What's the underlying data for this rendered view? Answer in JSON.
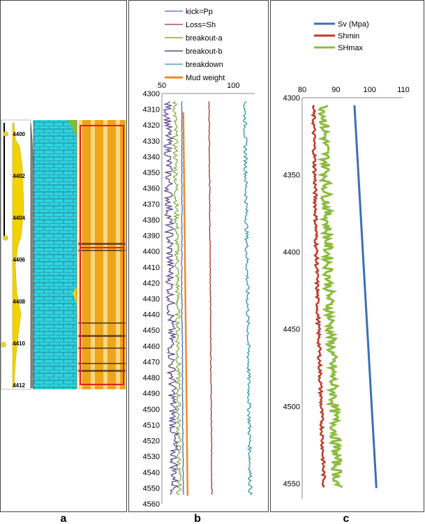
{
  "panel_labels": [
    "a",
    "b",
    "c"
  ],
  "panel_a": {
    "depth_ticks": [
      "4400",
      "4402",
      "4404",
      "4406",
      "4408",
      "4410",
      "4412"
    ],
    "colors": {
      "limestone": "#2fd2e0",
      "brick_line": "#1f6f76",
      "gamma": "#f2d200",
      "core": "#f0a419",
      "core_box": "#e02020"
    }
  },
  "chart_data": [
    {
      "type": "line",
      "x_ticks": [
        "50",
        "100"
      ],
      "xlim": [
        50,
        115
      ],
      "y_ticks": [
        "4300",
        "4310",
        "4320",
        "4330",
        "4340",
        "4350",
        "4360",
        "4370",
        "4380",
        "4390",
        "4400",
        "4410",
        "4420",
        "4430",
        "4440",
        "4450",
        "4460",
        "4470",
        "4480",
        "4490",
        "4500",
        "4510",
        "4520",
        "4530",
        "4540",
        "4550",
        "4560"
      ],
      "ylim": [
        4300,
        4560
      ],
      "y_inverted": true,
      "legend": [
        "kick=Pp",
        "Loss=Sh",
        "breakout-a",
        "breakout-b",
        "breakdown",
        "Mud weight"
      ],
      "series": [
        {
          "name": "kick=Pp",
          "color": "#3b6fb6",
          "x": [
            64,
            64,
            65
          ],
          "y": [
            4305,
            4430,
            4555
          ]
        },
        {
          "name": "Loss=Sh",
          "color": "#a0322d",
          "x": [
            83,
            84,
            85
          ],
          "y": [
            4305,
            4430,
            4555
          ]
        },
        {
          "name": "breakout-a",
          "color": "#7fad3a",
          "x": [
            59,
            61,
            62
          ],
          "y": [
            4305,
            4430,
            4555
          ]
        },
        {
          "name": "breakout-b",
          "color": "#5b4691",
          "x": [
            54,
            56,
            59
          ],
          "y": [
            4305,
            4430,
            4555
          ]
        },
        {
          "name": "breakdown",
          "color": "#2f94a5",
          "x": [
            108,
            110,
            112
          ],
          "y": [
            4305,
            4430,
            4555
          ]
        },
        {
          "name": "Mud weight",
          "color": "#ee8a2b",
          "x": [
            65,
            68
          ],
          "y": [
            4312,
            4555
          ]
        }
      ]
    },
    {
      "type": "line",
      "x_ticks": [
        "80",
        "90",
        "100",
        "110"
      ],
      "xlim": [
        80,
        110
      ],
      "y_ticks": [
        "4300",
        "4350",
        "4400",
        "4450",
        "4500",
        "4550"
      ],
      "ylim": [
        4300,
        4560
      ],
      "y_inverted": true,
      "legend": [
        "Sv (Mpa)",
        "Shmin",
        "SHmax"
      ],
      "series": [
        {
          "name": "Sv (Mpa)",
          "color": "#3b6fb6",
          "x": [
            95.5,
            102
          ],
          "y": [
            4305,
            4553
          ]
        },
        {
          "name": "Shmin",
          "color": "#c0392b",
          "x": [
            83.3,
            84.5,
            86.5
          ],
          "y": [
            4305,
            4430,
            4553
          ]
        },
        {
          "name": "SHmax",
          "color": "#8cbb3e",
          "x": [
            86.5,
            88,
            90.5
          ],
          "y": [
            4305,
            4430,
            4553
          ]
        }
      ]
    }
  ]
}
